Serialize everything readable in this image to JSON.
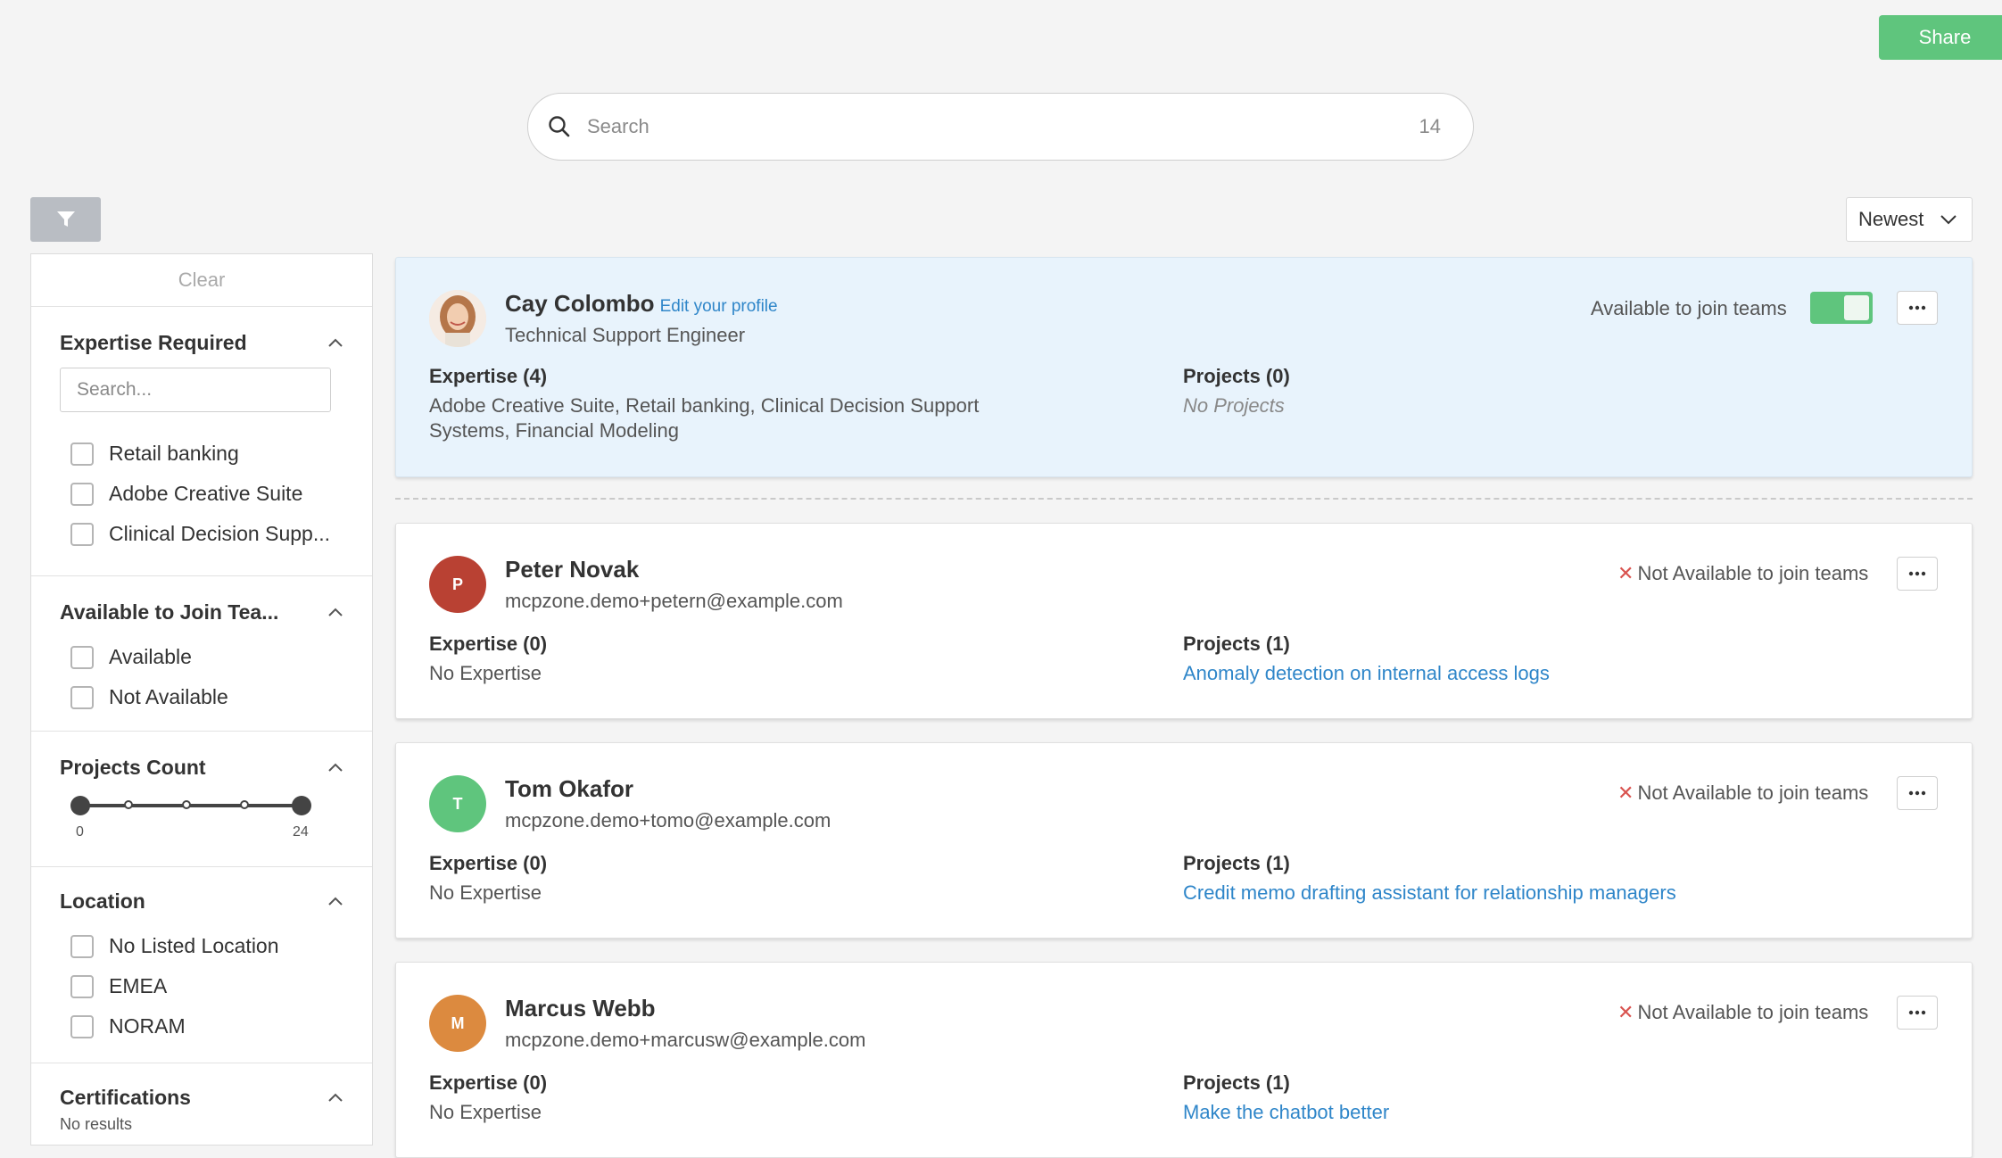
{
  "header": {
    "share_label": "Share"
  },
  "search": {
    "placeholder": "Search",
    "count": "14"
  },
  "sort": {
    "selected": "Newest"
  },
  "filters": {
    "clear_label": "Clear",
    "expertise": {
      "title": "Expertise Required",
      "search_placeholder": "Search...",
      "options": [
        "Retail banking",
        "Adobe Creative Suite",
        "Clinical Decision Supp..."
      ]
    },
    "availability": {
      "title": "Available to Join Tea...",
      "options": [
        "Available",
        "Not Available"
      ]
    },
    "projects_count": {
      "title": "Projects Count",
      "min_label": "0",
      "max_label": "24",
      "range": [
        0,
        24
      ]
    },
    "location": {
      "title": "Location",
      "options": [
        "No Listed Location",
        "EMEA",
        "NORAM"
      ]
    },
    "certifications": {
      "title": "Certifications",
      "empty_text": "No results"
    }
  },
  "people": [
    {
      "name": "Cay Colombo",
      "edit_link": "Edit your profile",
      "subtitle": "Technical Support Engineer",
      "availability_label": "Available to join teams",
      "available": true,
      "expertise_title": "Expertise (4)",
      "expertise_text": "Adobe Creative Suite, Retail banking, Clinical Decision Support Systems, Financial Modeling",
      "projects_title": "Projects (0)",
      "projects_text": "No Projects"
    },
    {
      "name": "Peter Novak",
      "initial": "P",
      "avatar_color": "#b94133",
      "subtitle": "mcpzone.demo+petern@example.com",
      "availability_label": "Not Available to join teams",
      "available": false,
      "expertise_title": "Expertise (0)",
      "expertise_text": "No Expertise",
      "projects_title": "Projects (1)",
      "projects_text": "Anomaly detection on internal access logs"
    },
    {
      "name": "Tom Okafor",
      "initial": "T",
      "avatar_color": "#5fc57d",
      "subtitle": "mcpzone.demo+tomo@example.com",
      "availability_label": "Not Available to join teams",
      "available": false,
      "expertise_title": "Expertise (0)",
      "expertise_text": "No Expertise",
      "projects_title": "Projects (1)",
      "projects_text": "Credit memo drafting assistant for relationship managers"
    },
    {
      "name": "Marcus Webb",
      "initial": "M",
      "avatar_color": "#dc8a3f",
      "subtitle": "mcpzone.demo+marcusw@example.com",
      "availability_label": "Not Available to join teams",
      "available": false,
      "expertise_title": "Expertise (0)",
      "expertise_text": "No Expertise",
      "projects_title": "Projects (1)",
      "projects_text": "Make the chatbot better"
    }
  ],
  "colors": {
    "accent_green": "#5fc57d",
    "link_blue": "#2f86c9",
    "self_card_bg": "#e8f3fc",
    "not_available_x": "#d9534f"
  }
}
